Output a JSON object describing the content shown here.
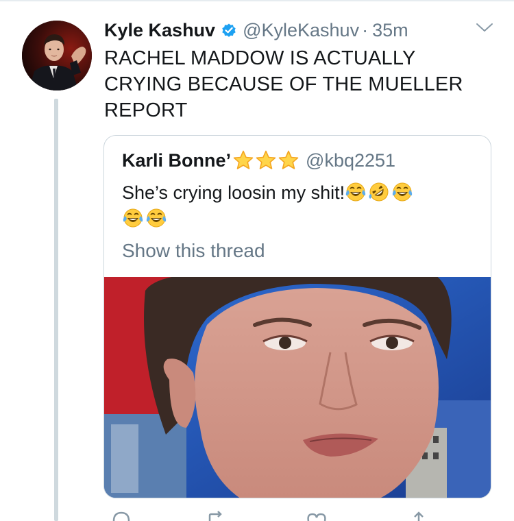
{
  "tweet": {
    "display_name": "Kyle Kashuv",
    "handle": "@KyleKashuv",
    "separator": "·",
    "time": "35m",
    "text": "RACHEL MADDOW IS ACTUALLY CRYING BECAUSE OF THE MUELLER REPORT",
    "icons": {
      "verified": "verified-badge-icon",
      "more": "chevron-down-icon"
    },
    "colors": {
      "verified_blue": "#1da1f2",
      "secondary_text": "#657786",
      "primary_text": "#14171a",
      "border": "#ccd6dd"
    }
  },
  "quoted_tweet": {
    "display_name": "Karli Bonne’",
    "handle": "@kbq2251",
    "text": "She’s crying loosin my shit!",
    "show_thread_label": "Show this thread",
    "name_emojis": [
      "star",
      "star",
      "star"
    ],
    "text_emojis": [
      "face-with-tears-of-joy",
      "rolling-on-the-floor-laughing",
      "face-with-tears-of-joy",
      "face-with-tears-of-joy",
      "face-with-tears-of-joy"
    ]
  },
  "actions": [
    "reply-icon",
    "retweet-icon",
    "like-icon",
    "share-icon"
  ]
}
